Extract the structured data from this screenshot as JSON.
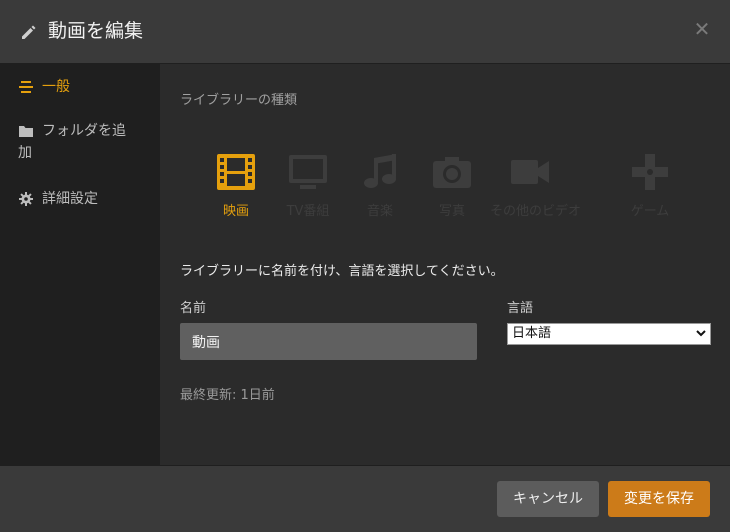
{
  "header": {
    "title": "動画を編集",
    "close_icon": "close-icon"
  },
  "sidebar": {
    "items": [
      {
        "label": "一般",
        "icon": "general-icon",
        "active": true
      },
      {
        "label": "フォルダを追加",
        "icon": "folder-icon",
        "active": false
      },
      {
        "label": "詳細設定",
        "icon": "gear-icon",
        "active": false
      }
    ]
  },
  "main": {
    "section_label": "ライブラリーの種類",
    "library_types": [
      {
        "label": "映画",
        "icon": "film-icon",
        "selected": true
      },
      {
        "label": "TV番組",
        "icon": "tv-icon",
        "selected": false
      },
      {
        "label": "音楽",
        "icon": "music-icon",
        "selected": false
      },
      {
        "label": "写真",
        "icon": "camera-icon",
        "selected": false
      },
      {
        "label": "その他のビデオ",
        "icon": "video-camera-icon",
        "selected": false
      },
      {
        "label": "ゲーム",
        "icon": "gamepad-icon",
        "selected": false
      }
    ],
    "instruction": "ライブラリーに名前を付け、言語を選択してください。",
    "name_label": "名前",
    "name_value": "動画",
    "language_label": "言語",
    "language_value": "日本語",
    "last_updated": "最終更新: 1日前"
  },
  "footer": {
    "cancel_label": "キャンセル",
    "save_label": "変更を保存"
  },
  "colors": {
    "accent": "#e5a00d",
    "save_button": "#cc7b19",
    "inactive_icon": "#3d3d3d"
  }
}
